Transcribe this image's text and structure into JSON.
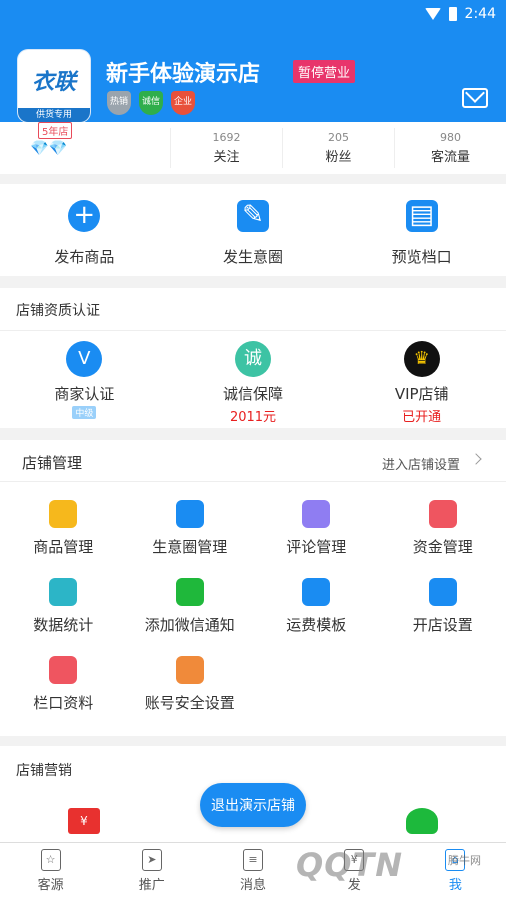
{
  "status_bar": {
    "time": "2:44"
  },
  "shop": {
    "logo_text": "衣联",
    "logo_sub": "供货专用",
    "years_badge": "5年店",
    "name": "新手体验演示店",
    "status_badge": "暂停营业",
    "badges": [
      {
        "label": "热销",
        "color": "#9aa4ad"
      },
      {
        "label": "诚信",
        "color": "#2fae4b"
      },
      {
        "label": "企业",
        "color": "#e8513a"
      }
    ]
  },
  "stats": {
    "diamonds": "💎💎",
    "items": [
      {
        "value": "1692",
        "label": "关注"
      },
      {
        "value": "205",
        "label": "粉丝"
      },
      {
        "value": "980",
        "label": "客流量"
      }
    ]
  },
  "quick_actions": [
    {
      "label": "发布商品",
      "icon": "plus-icon"
    },
    {
      "label": "发生意圈",
      "icon": "edit-icon"
    },
    {
      "label": "预览档口",
      "icon": "storefront-icon"
    }
  ],
  "certification": {
    "title": "店铺资质认证",
    "items": [
      {
        "label": "商家认证",
        "sub": "中级",
        "sub_color": "#ffffff",
        "icon": "v-diamond-icon",
        "icon_text": "V",
        "icon_color": "#1a8cf2"
      },
      {
        "label": "诚信保障",
        "sub": "2011元",
        "sub_color": "#e82020",
        "icon": "integrity-shield-icon",
        "icon_text": "诚",
        "icon_color": "#3dc3a4"
      },
      {
        "label": "VIP店铺",
        "sub": "已开通",
        "sub_color": "#e82020",
        "icon": "crown-icon",
        "icon_text": "♛",
        "icon_color": "#111111"
      }
    ]
  },
  "management": {
    "title": "店铺管理",
    "link": "进入店铺设置",
    "items": [
      {
        "label": "商品管理",
        "icon": "shopping-bag-icon",
        "color": "#f6b81c"
      },
      {
        "label": "生意圈管理",
        "icon": "aperture-icon",
        "color": "#1a8cf2"
      },
      {
        "label": "评论管理",
        "icon": "comment-icon",
        "color": "#8f7df2"
      },
      {
        "label": "资金管理",
        "icon": "money-bag-icon",
        "color": "#ef5560"
      },
      {
        "label": "数据统计",
        "icon": "bar-chart-icon",
        "color": "#2cb5c7"
      },
      {
        "label": "添加微信通知",
        "icon": "wechat-icon",
        "color": "#1fb83b"
      },
      {
        "label": "运费模板",
        "icon": "truck-icon",
        "color": "#1a8cf2"
      },
      {
        "label": "开店设置",
        "icon": "shop-settings-icon",
        "color": "#1a8cf2"
      },
      {
        "label": "栏口资料",
        "icon": "id-card-icon",
        "color": "#ef5560"
      },
      {
        "label": "账号安全设置",
        "icon": "account-security-icon",
        "color": "#f08a3a"
      }
    ]
  },
  "marketing": {
    "title": "店铺营销"
  },
  "exit_button": "退出演示店铺",
  "bottom_nav": [
    {
      "label": "客源",
      "icon": "star-icon",
      "glyph": "☆"
    },
    {
      "label": "推广",
      "icon": "paper-plane-icon",
      "glyph": "➤"
    },
    {
      "label": "消息",
      "icon": "message-icon",
      "glyph": "≡"
    },
    {
      "label": "发",
      "icon": "yuan-icon",
      "glyph": "¥"
    },
    {
      "label": "我",
      "icon": "shop-icon",
      "glyph": "⌂"
    }
  ],
  "watermark": {
    "text": "QQTN",
    "small": "腾牛网"
  }
}
